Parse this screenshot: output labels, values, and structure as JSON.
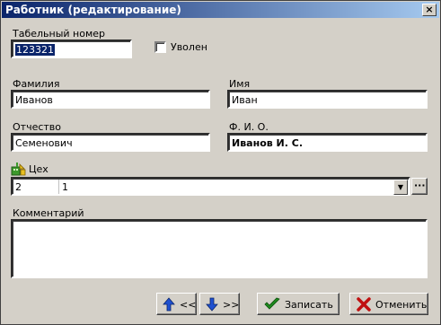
{
  "window": {
    "title": "Работник (редактирование)",
    "close_glyph": "×"
  },
  "tab_number": {
    "label": "Табельный номер",
    "value": "123321"
  },
  "dismissed": {
    "label": "Уволен",
    "checked": false
  },
  "last_name": {
    "label": "Фамилия",
    "value": "Иванов"
  },
  "first_name": {
    "label": "Имя",
    "value": "Иван"
  },
  "patronymic": {
    "label": "Отчество",
    "value": "Семенович"
  },
  "full_name": {
    "label": "Ф. И. О.",
    "value": "Иванов И. С."
  },
  "workshop": {
    "label": "Цех",
    "code": "2",
    "name": "1",
    "dropdown_glyph": "▼",
    "browse_glyph": "···"
  },
  "comment": {
    "label": "Комментарий",
    "value": ""
  },
  "buttons": {
    "prev_label": "<<",
    "next_label": ">>",
    "save_label": "Записать",
    "cancel_label": "Отменить"
  },
  "colors": {
    "titlebar_start": "#0a246a",
    "titlebar_end": "#a6caf0",
    "face": "#d4d0c8"
  },
  "icons": [
    "workshop-icon",
    "arrow-up-icon",
    "arrow-down-icon",
    "checkmark-icon",
    "cross-icon"
  ]
}
